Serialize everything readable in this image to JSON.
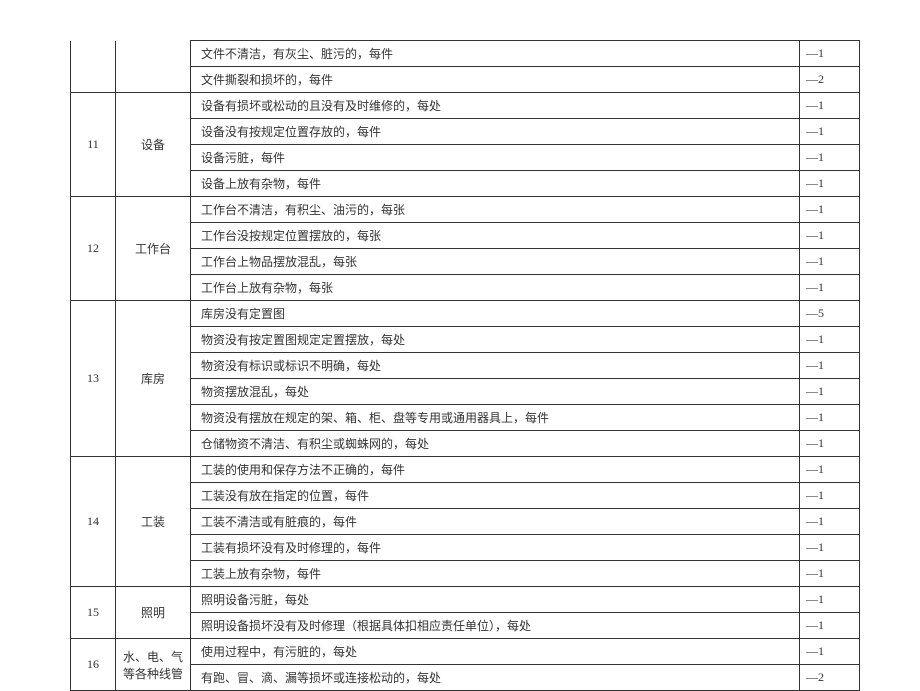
{
  "sections": [
    {
      "num": "",
      "cat": "",
      "continued": true,
      "rows": [
        {
          "desc": "文件不清洁，有灰尘、脏污的，每件",
          "score": "—1"
        },
        {
          "desc": "文件撕裂和损坏的，每件",
          "score": "—2"
        }
      ]
    },
    {
      "num": "11",
      "cat": "设备",
      "rows": [
        {
          "desc": "设备有损坏或松动的且没有及时维修的，每处",
          "score": "—1"
        },
        {
          "desc": "设备没有按规定位置存放的，每件",
          "score": "—1"
        },
        {
          "desc": "设备污脏，每件",
          "score": "—1"
        },
        {
          "desc": "设备上放有杂物，每件",
          "score": "—1"
        }
      ]
    },
    {
      "num": "12",
      "cat": "工作台",
      "rows": [
        {
          "desc": "工作台不清洁，有积尘、油污的，每张",
          "score": "—1"
        },
        {
          "desc": "工作台没按规定位置摆放的，每张",
          "score": "—1"
        },
        {
          "desc": "工作台上物品摆放混乱，每张",
          "score": "—1"
        },
        {
          "desc": "工作台上放有杂物，每张",
          "score": "—1"
        }
      ]
    },
    {
      "num": "13",
      "cat": "库房",
      "rows": [
        {
          "desc": "库房没有定置图",
          "score": "—5"
        },
        {
          "desc": "物资没有按定置图规定定置摆放，每处",
          "score": "—1"
        },
        {
          "desc": "物资没有标识或标识不明确，每处",
          "score": "—1"
        },
        {
          "desc": "物资摆放混乱，每处",
          "score": "—1"
        },
        {
          "desc": "物资没有摆放在规定的架、箱、柜、盘等专用或通用器具上，每件",
          "score": "—1"
        },
        {
          "desc": "仓储物资不清洁、有积尘或蜘蛛网的，每处",
          "score": "—1"
        }
      ]
    },
    {
      "num": "14",
      "cat": "工装",
      "rows": [
        {
          "desc": "工装的使用和保存方法不正确的，每件",
          "score": "—1"
        },
        {
          "desc": "工装没有放在指定的位置，每件",
          "score": "—1"
        },
        {
          "desc": "工装不清洁或有脏痕的，每件",
          "score": "—1"
        },
        {
          "desc": "工装有损坏没有及时修理的，每件",
          "score": "—1"
        },
        {
          "desc": "工装上放有杂物，每件",
          "score": "—1"
        }
      ]
    },
    {
      "num": "15",
      "cat": "照明",
      "rows": [
        {
          "desc": "照明设备污脏，每处",
          "score": "—1"
        },
        {
          "desc": "照明设备损坏没有及时修理（根据具体扣相应责任单位），每处",
          "score": "—1"
        }
      ]
    },
    {
      "num": "16",
      "cat": "水、电、气等各种线管",
      "rows": [
        {
          "desc": "使用过程中，有污脏的，每处",
          "score": "—1"
        },
        {
          "desc": "有跑、冒、滴、漏等损坏或连接松动的，每处",
          "score": "—2"
        }
      ]
    }
  ]
}
